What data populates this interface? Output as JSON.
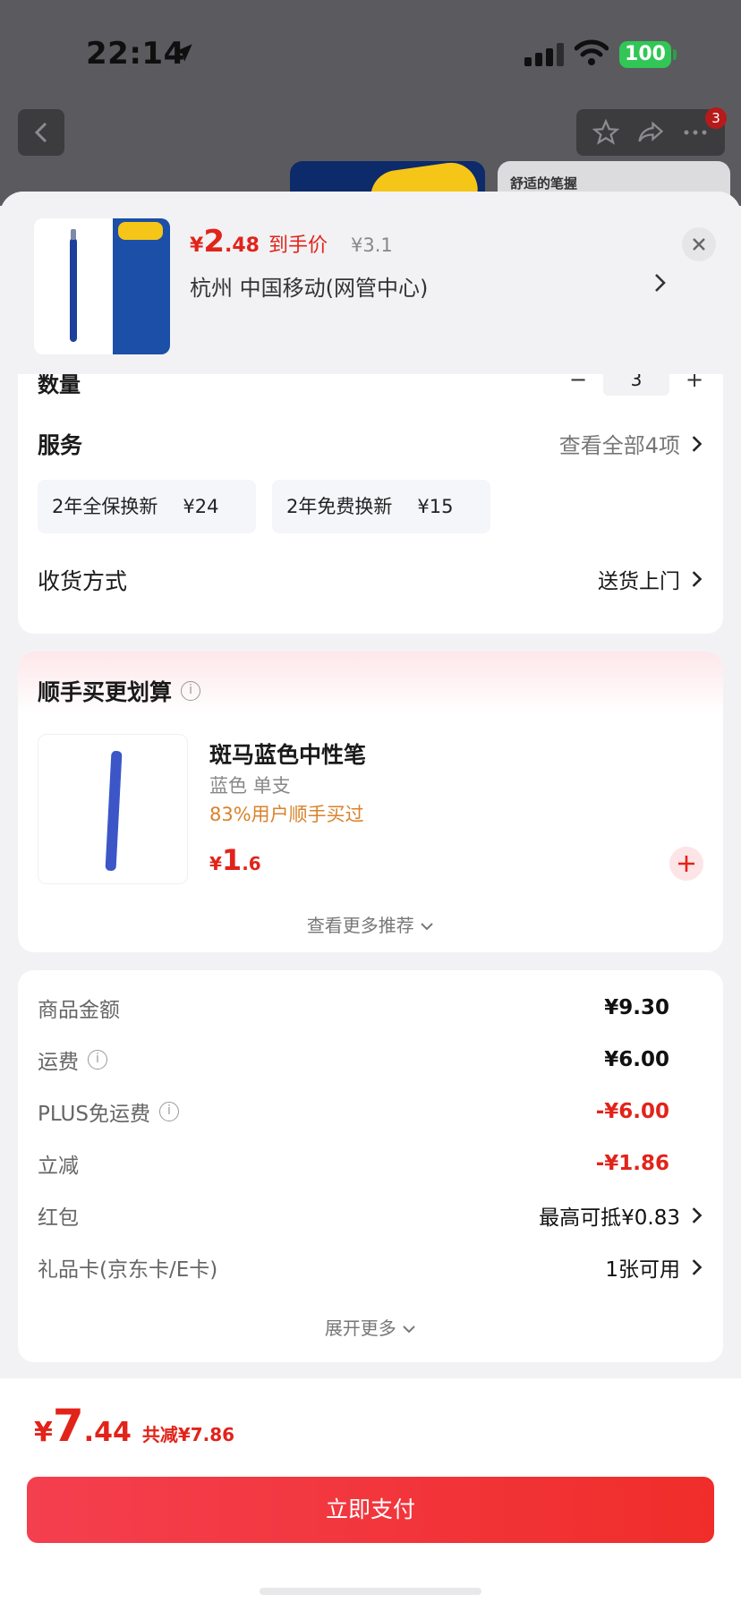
{
  "status_bar": {
    "time": "22:14",
    "battery": "100"
  },
  "background_page": {
    "badge_count": "3",
    "promo_card_text": "舒适的笔握"
  },
  "header": {
    "price_currency": "¥",
    "price_int": "2",
    "price_dec": ".48",
    "price_tag": "到手价",
    "original_price": "¥3.1",
    "address": "杭州  中国移动(网管中心)"
  },
  "quantity": {
    "label": "数量",
    "value": "3",
    "minus": "−",
    "plus": "+"
  },
  "service": {
    "label": "服务",
    "view_all": "查看全部4项",
    "options": [
      {
        "name": "2年全保换新",
        "price": "¥24"
      },
      {
        "name": "2年免费换新",
        "price": "¥15"
      }
    ]
  },
  "shipping": {
    "label": "收货方式",
    "value": "送货上门"
  },
  "recommend": {
    "title": "顺手买更划算",
    "item_name": "斑马蓝色中性笔",
    "item_spec": "蓝色 单支",
    "item_bought": "83%用户顺手买过",
    "price_currency": "¥",
    "price_int": "1",
    "price_dec": ".6",
    "more": "查看更多推荐"
  },
  "fees": {
    "goods_label": "商品金额",
    "goods_value": "¥9.30",
    "freight_label": "运费",
    "freight_value": "¥6.00",
    "plus_label": "PLUS免运费",
    "plus_value": "-¥6.00",
    "discount_label": "立减",
    "discount_value": "-¥1.86",
    "redpacket_label": "红包",
    "redpacket_value": "最高可抵¥0.83",
    "giftcard_label": "礼品卡(京东卡/E卡)",
    "giftcard_value": "1张可用",
    "expand": "展开更多"
  },
  "footer": {
    "total_currency": "¥",
    "total_int": "7",
    "total_dec": ".44",
    "total_saved": "共减¥7.86",
    "pay_label": "立即支付"
  },
  "colors": {
    "accent_red": "#e2231a",
    "pay_button": "#f02d2a",
    "recommend_orange": "#d9822b"
  }
}
